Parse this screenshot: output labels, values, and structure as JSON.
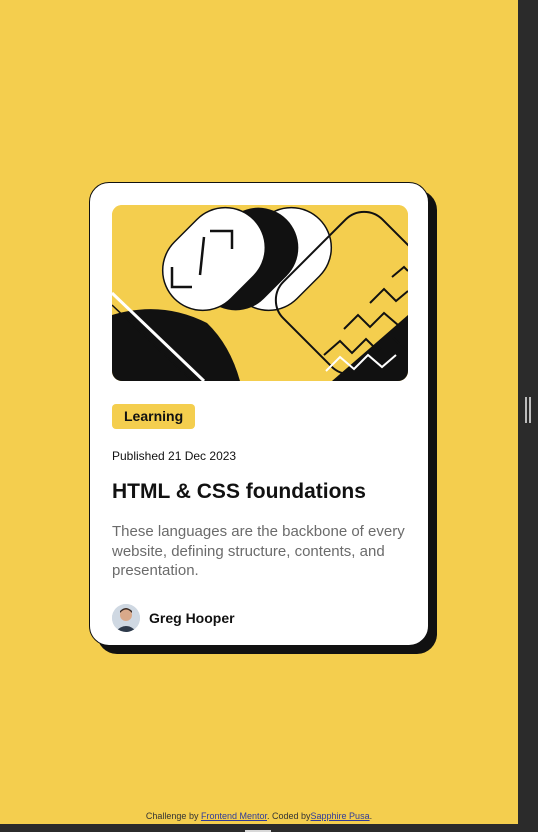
{
  "card": {
    "tag": "Learning",
    "published": "Published 21 Dec 2023",
    "title": "HTML & CSS foundations",
    "description": "These languages are the backbone of every website, defining structure, contents, and presentation.",
    "author": "Greg Hooper"
  },
  "footer": {
    "challenge_prefix": "Challenge by ",
    "challenge_link": "Frontend Mentor",
    "coded_prefix": ". Coded by",
    "coder_link": "Sapphire Pusa",
    "suffix": "."
  },
  "colors": {
    "background": "#f4ce4e",
    "card": "#ffffff",
    "ink": "#111111",
    "muted_text": "#6b6b6b"
  },
  "icons": {
    "hero": "abstract-illustration",
    "avatar": "author-avatar"
  }
}
